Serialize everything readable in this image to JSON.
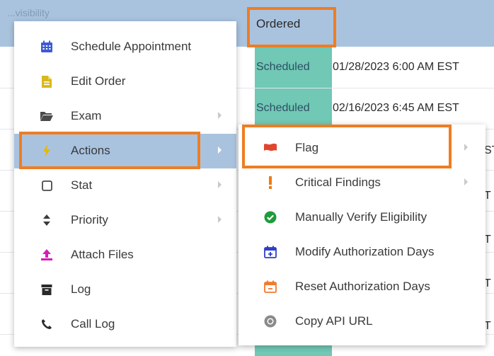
{
  "table": {
    "header_partial": "...visibility",
    "status_header": "Ordered",
    "rows": [
      {
        "status": "Scheduled",
        "date": "01/28/2023 6:00 AM EST"
      },
      {
        "status": "Scheduled",
        "date": "02/16/2023 6:45 AM EST"
      }
    ],
    "peek_chars": [
      "ST",
      "T",
      "T",
      "T",
      "T",
      "T"
    ]
  },
  "context_menu": {
    "items": [
      {
        "label": "Schedule Appointment",
        "icon": "calendar-icon",
        "submenu": false
      },
      {
        "label": "Edit Order",
        "icon": "document-icon",
        "submenu": false
      },
      {
        "label": "Exam",
        "icon": "folder-icon",
        "submenu": true
      },
      {
        "label": "Actions",
        "icon": "lightning-icon",
        "submenu": true,
        "active": true
      },
      {
        "label": "Stat",
        "icon": "checkbox-icon",
        "submenu": true
      },
      {
        "label": "Priority",
        "icon": "sort-icon",
        "submenu": true
      },
      {
        "label": "Attach Files",
        "icon": "upload-icon",
        "submenu": false
      },
      {
        "label": "Log",
        "icon": "archive-icon",
        "submenu": false
      },
      {
        "label": "Call Log",
        "icon": "phone-icon",
        "submenu": false
      }
    ]
  },
  "actions_submenu": {
    "items": [
      {
        "label": "Flag",
        "icon": "flag-icon",
        "submenu": true
      },
      {
        "label": "Critical Findings",
        "icon": "exclamation-icon",
        "submenu": true
      },
      {
        "label": "Manually Verify Eligibility",
        "icon": "check-circle-icon",
        "submenu": false
      },
      {
        "label": "Modify Authorization Days",
        "icon": "calendar-plus-icon",
        "submenu": false
      },
      {
        "label": "Reset Authorization Days",
        "icon": "calendar-minus-icon",
        "submenu": false
      },
      {
        "label": "Copy API URL",
        "icon": "chrome-icon",
        "submenu": false
      }
    ]
  },
  "colors": {
    "header_blue": "#a9c3df",
    "status_teal": "#70c8b5",
    "highlight_orange": "#ef7d22"
  }
}
